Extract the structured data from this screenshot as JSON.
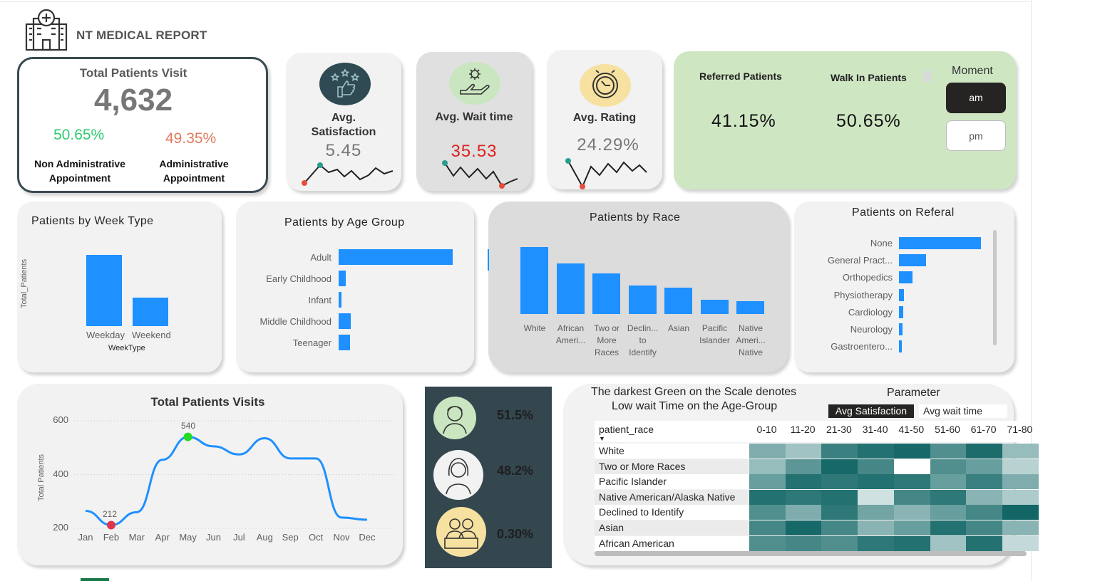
{
  "report_title": "NT MEDICAL REPORT",
  "total_visits": {
    "title": "Total Patients Visit",
    "value": "4,632",
    "non_admin_pct": "50.65%",
    "non_admin_label": "Non Administrative Appointment",
    "admin_pct": "49.35%",
    "admin_label": "Administrative Appointment"
  },
  "metrics": [
    {
      "title": "Avg. Satisfaction",
      "value": "5.45",
      "icon": "stars-thumbs-up-icon",
      "icon_bg": "#2f4a52",
      "value_color": "#777777"
    },
    {
      "title": "Avg. Wait time",
      "value": "35.53",
      "icon": "hand-gear-icon",
      "icon_bg": "#c9e6c1",
      "value_color": "#e02020"
    },
    {
      "title": "Avg. Rating",
      "value": "24.29%",
      "icon": "clock-icon",
      "icon_bg": "#f6e1a0",
      "value_color": "#777777"
    }
  ],
  "referral_summary": {
    "referred_label": "Referred Patients",
    "referred_value": "41.15%",
    "walkin_label": "Walk In Patients",
    "walkin_value": "50.65%"
  },
  "moment_slicer": {
    "title": "Moment",
    "options": [
      "am",
      "pm"
    ],
    "selected": "am"
  },
  "week_type": {
    "title": "Patients by Week Type",
    "ylabel": "Total_Patients",
    "xlabel": "WeekType",
    "categories": [
      "Weekday",
      "Weekend"
    ]
  },
  "age_group": {
    "title": "Patients by Age Group",
    "categories": [
      "Adult",
      "Early Childhood",
      "Infant",
      "Middle Childhood",
      "Teenager"
    ]
  },
  "race": {
    "title": "Patients by Race",
    "categories": [
      "White",
      "African Ameri...",
      "Two or More Races",
      "Declin... to Identify",
      "Asian",
      "Pacific Islander",
      "Native Ameri... Native"
    ]
  },
  "referral": {
    "title": "Patients on Referal",
    "categories": [
      "None",
      "General Pract...",
      "Orthopedics",
      "Physiotherapy",
      "Cardiology",
      "Neurology",
      "Gastroentero..."
    ]
  },
  "monthly": {
    "title": "Total Patients Visits",
    "ylabel": "Total Patients",
    "yticks": [
      "600",
      "400",
      "200"
    ],
    "months": [
      "Jan",
      "Feb",
      "Mar",
      "Apr",
      "May",
      "Jun",
      "Jul",
      "Aug",
      "Sep",
      "Oct",
      "Nov",
      "Dec"
    ],
    "max_label": "540",
    "min_label": "212"
  },
  "gender": [
    {
      "icon": "male-avatar-icon",
      "value": "51.5%",
      "bg": "#c9e6c1"
    },
    {
      "icon": "female-avatar-icon",
      "value": "48.2%",
      "bg": "#f2f2f2"
    },
    {
      "icon": "couple-avatar-icon",
      "value": "0.30%",
      "bg": "#f6e1a0"
    }
  ],
  "heatmap": {
    "note_line1": "The darkest Green on the Scale denotes",
    "note_line2": "Low wait Time on the Age-Group",
    "parameter_title": "Parameter",
    "parameter_options": [
      "Avg Satisfaction",
      "Avg wait time"
    ],
    "parameter_selected": "Avg Satisfaction",
    "row_header": "patient_race",
    "columns": [
      "0-10",
      "11-20",
      "21-30",
      "31-40",
      "41-50",
      "51-60",
      "61-70",
      "71-80"
    ],
    "rows": [
      "White",
      "Two or More Races",
      "Pacific Islander",
      "Native American/Alaska Native",
      "Declined to Identify",
      "Asian",
      "African American"
    ]
  },
  "chart_data": [
    {
      "type": "bar",
      "title": "Patients by Week Type",
      "xlabel": "WeekType",
      "ylabel": "Total_Patients",
      "categories": [
        "Weekday",
        "Weekend"
      ],
      "values": [
        3300,
        1330
      ]
    },
    {
      "type": "bar",
      "orientation": "horizontal",
      "title": "Patients by Age Group",
      "categories": [
        "Adult",
        "Early Childhood",
        "Infant",
        "Middle Childhood",
        "Teenager"
      ],
      "values": [
        3400,
        210,
        90,
        370,
        350
      ]
    },
    {
      "type": "bar",
      "title": "Patients by Race",
      "categories": [
        "White",
        "African Ameri...",
        "Two or More Races",
        "Declin... to Identify",
        "Asian",
        "Pacific Islander",
        "Native Ameri... Native"
      ],
      "values": [
        1100,
        830,
        670,
        470,
        430,
        230,
        210
      ]
    },
    {
      "type": "bar",
      "orientation": "horizontal",
      "title": "Patients on Referal",
      "categories": [
        "None",
        "General Pract...",
        "Orthopedics",
        "Physiotherapy",
        "Cardiology",
        "Neurology",
        "Gastroentero..."
      ],
      "values": [
        2700,
        900,
        450,
        160,
        130,
        110,
        100
      ]
    },
    {
      "type": "line",
      "title": "Total Patients Visits",
      "ylabel": "Total Patients",
      "x": [
        "Jan",
        "Feb",
        "Mar",
        "Apr",
        "May",
        "Jun",
        "Jul",
        "Aug",
        "Sep",
        "Oct",
        "Nov",
        "Dec"
      ],
      "values": [
        265,
        212,
        260,
        455,
        540,
        505,
        475,
        535,
        460,
        460,
        240,
        232
      ],
      "ylim": [
        200,
        630
      ]
    },
    {
      "type": "heatmap",
      "x": [
        "0-10",
        "11-20",
        "21-30",
        "31-40",
        "41-50",
        "51-60",
        "61-70",
        "71-80"
      ],
      "y": [
        "White",
        "Two or More Races",
        "Pacific Islander",
        "Native American/Alaska Native",
        "Declined to Identify",
        "Asian",
        "African American"
      ],
      "values": [
        [
          0.45,
          0.3,
          0.75,
          0.85,
          0.9,
          0.65,
          0.88,
          0.35
        ],
        [
          0.35,
          0.6,
          0.9,
          0.7,
          0.0,
          0.65,
          0.55,
          0.2
        ],
        [
          0.55,
          0.85,
          0.8,
          0.85,
          0.8,
          0.55,
          0.75,
          0.45
        ],
        [
          0.85,
          0.8,
          0.85,
          0.1,
          0.7,
          0.8,
          0.4,
          0.25
        ],
        [
          0.65,
          0.45,
          0.8,
          0.5,
          0.4,
          0.55,
          0.7,
          0.92
        ],
        [
          0.7,
          0.9,
          0.7,
          0.4,
          0.55,
          0.85,
          0.7,
          0.4
        ],
        [
          0.65,
          0.7,
          0.65,
          0.8,
          0.85,
          0.3,
          0.85,
          0.15
        ]
      ]
    }
  ]
}
